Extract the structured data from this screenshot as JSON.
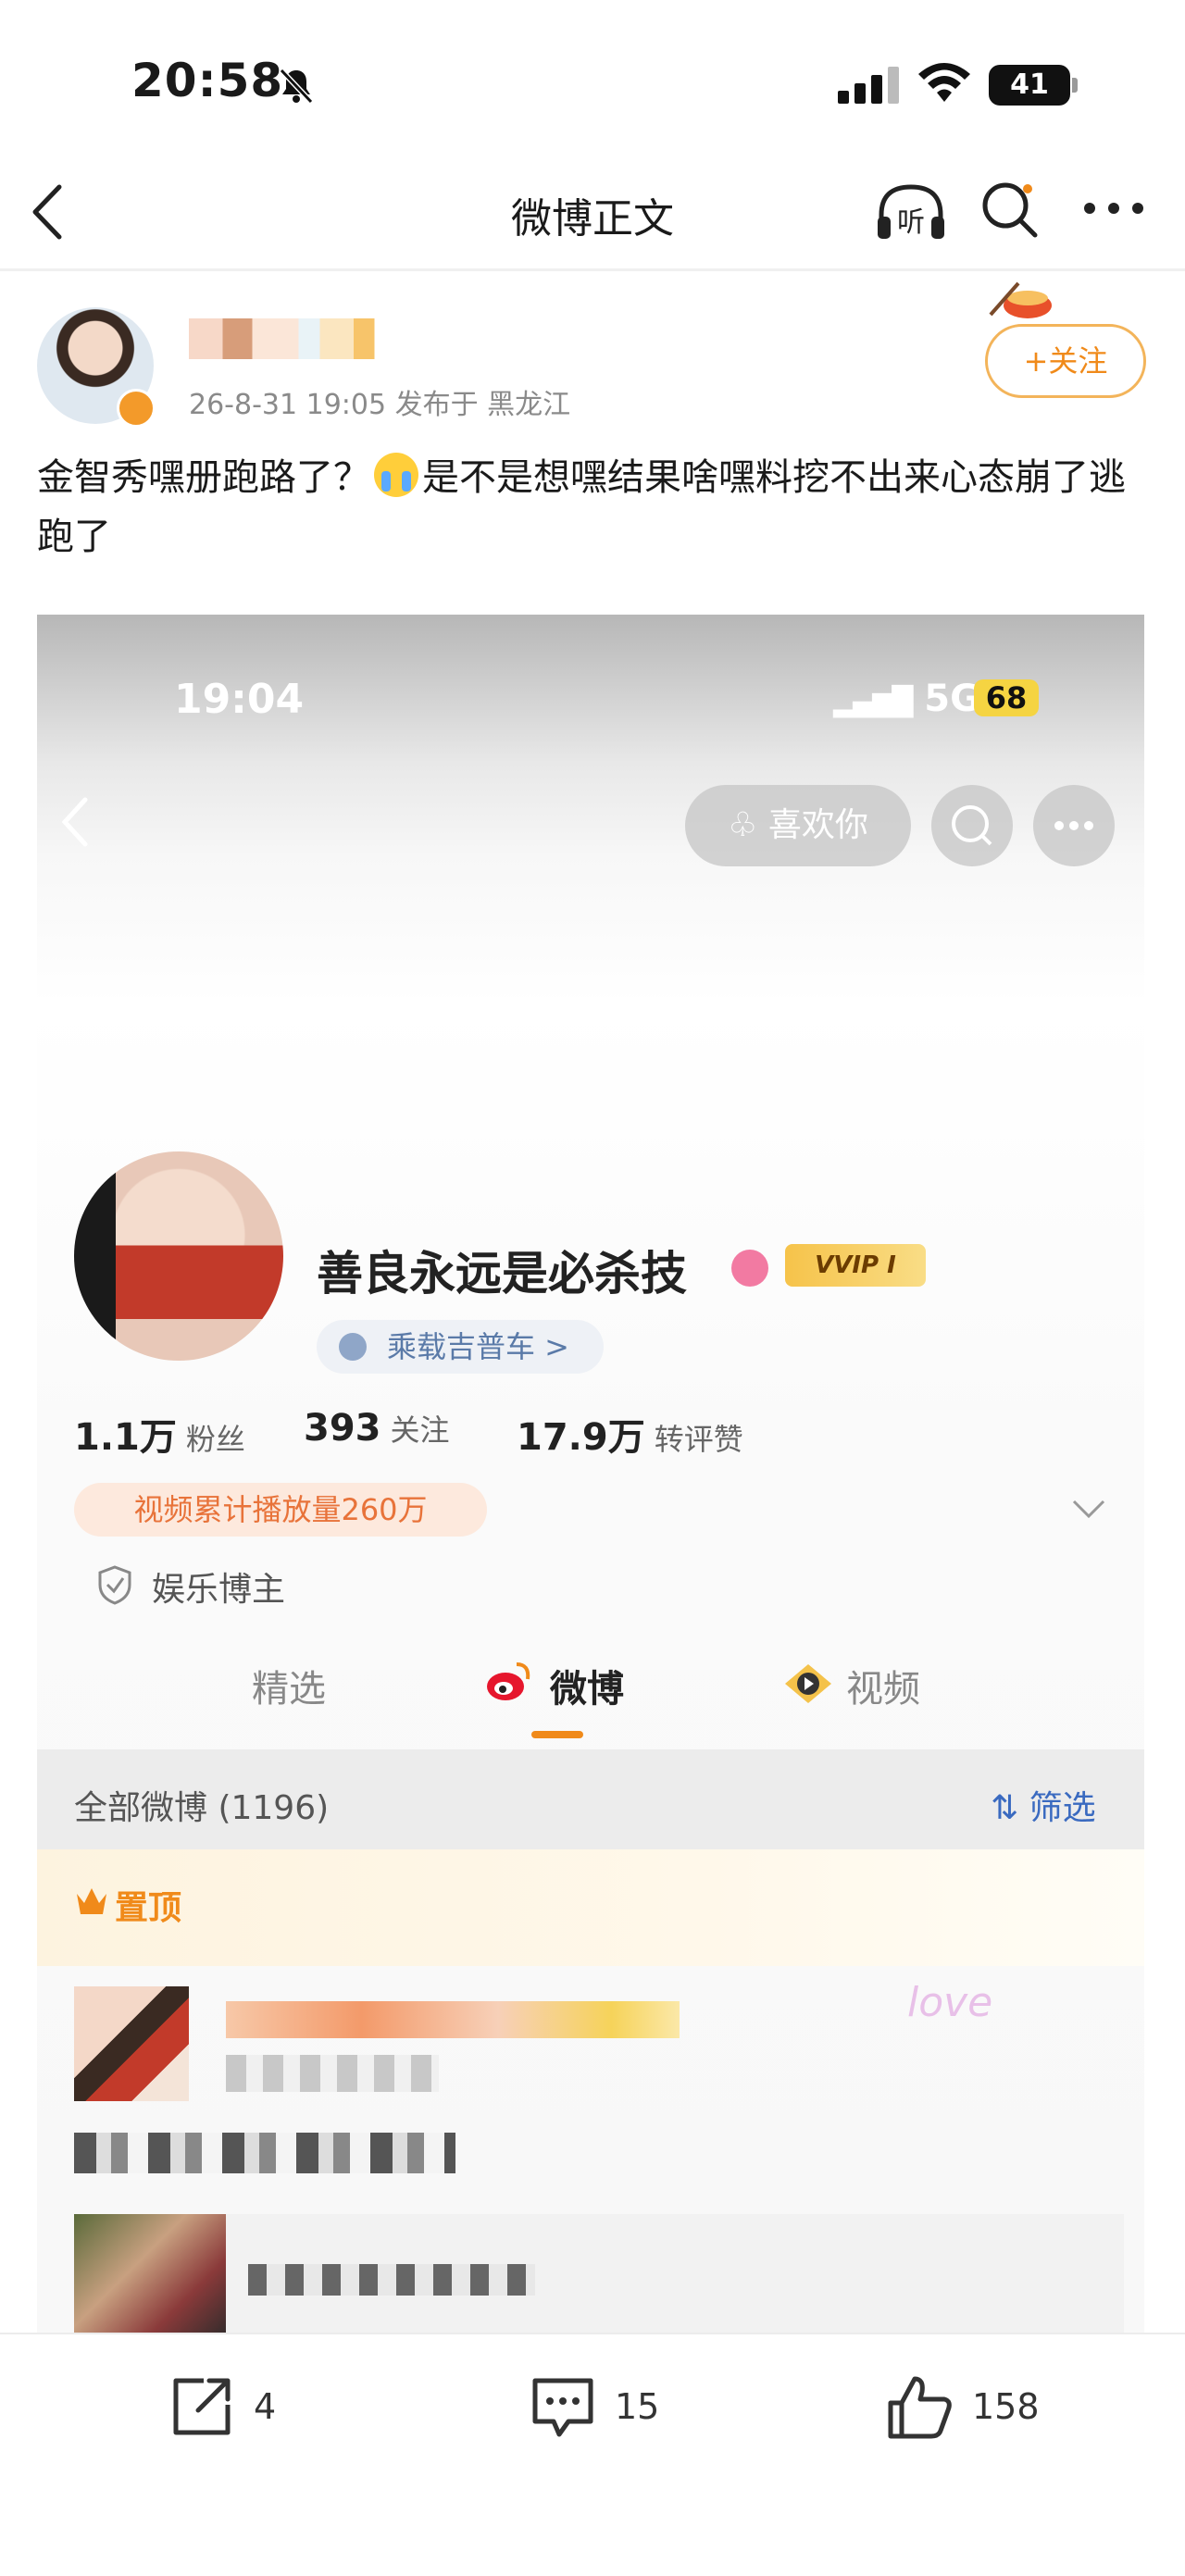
{
  "status_bar": {
    "time": "20:58",
    "battery": "41"
  },
  "nav": {
    "title": "微博正文"
  },
  "post": {
    "meta": "26-8-31 19:05  发布于 黑龙江",
    "follow_label": "+关注",
    "text_before_emoji": "金智秀嘿册跑路了？",
    "text_after_emoji": "是不是想嘿结果啥嘿料挖不出来心态崩了逃跑了"
  },
  "screenshot": {
    "status_time": "19:04",
    "network": "5G",
    "battery": "68",
    "like_you": "喜欢你",
    "profile_name": "善良永远是必杀技",
    "vip_badge": "VVIP Ⅰ",
    "chip_label": "乘载吉普车 >",
    "stats": [
      {
        "value": "1.1万",
        "label": "粉丝"
      },
      {
        "value": "393",
        "label": "关注"
      },
      {
        "value": "17.9万",
        "label": "转评赞"
      }
    ],
    "play_count": "视频累计播放量260万",
    "tag": "娱乐博主",
    "tabs": [
      "精选",
      "微博",
      "视频"
    ],
    "all_weibo": "全部微博 (1196)",
    "filter": "筛选",
    "pinned": "置顶",
    "love_deco": "love"
  },
  "toolbar": {
    "share_count": "4",
    "comment_count": "15",
    "like_count": "158"
  },
  "colors": {
    "accent": "#f08a1a",
    "link_blue": "#3a6ac0"
  },
  "icons": [
    "back-icon",
    "listen-icon",
    "search-icon",
    "more-icon",
    "share-icon",
    "comment-icon",
    "like-icon"
  ]
}
